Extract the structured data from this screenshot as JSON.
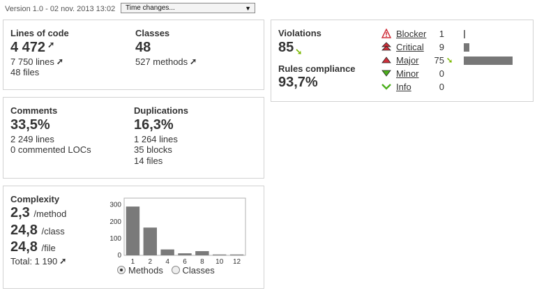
{
  "header": {
    "version_text": "Version 1.0 - 02 nov. 2013 13:02",
    "time_select": "Time changes..."
  },
  "size": {
    "loc_title": "Lines of code",
    "loc_value": "4 472",
    "lines": "7 750 lines",
    "files": "48 files",
    "classes_title": "Classes",
    "classes_value": "48",
    "methods": "527 methods"
  },
  "comments": {
    "title": "Comments",
    "value": "33,5%",
    "lines": "2 249 lines",
    "commented_locs": "0 commented LOCs"
  },
  "duplications": {
    "title": "Duplications",
    "value": "16,3%",
    "lines": "1 264 lines",
    "blocks": "35 blocks",
    "files": "14 files"
  },
  "complexity": {
    "title": "Complexity",
    "per_method_value": "2,3",
    "per_method_unit": "/method",
    "per_class_value": "24,8",
    "per_class_unit": "/class",
    "per_file_value": "24,8",
    "per_file_unit": "/file",
    "total": "Total: 1 190",
    "radio_methods": "Methods",
    "radio_classes": "Classes",
    "selected": "Methods"
  },
  "violations": {
    "title": "Violations",
    "value": "85",
    "compliance_title": "Rules compliance",
    "compliance_value": "93,7%",
    "severities": [
      {
        "label": "Blocker",
        "count": "1",
        "value": 1,
        "icon": "blocker-icon",
        "color": "#d02f3a"
      },
      {
        "label": "Critical",
        "count": "9",
        "value": 9,
        "icon": "critical-icon",
        "color": "#d02f3a"
      },
      {
        "label": "Major",
        "count": "75",
        "value": 75,
        "icon": "major-icon",
        "color": "#d02f3a"
      },
      {
        "label": "Minor",
        "count": "0",
        "value": 0,
        "icon": "minor-icon",
        "color": "#4caf1c"
      },
      {
        "label": "Info",
        "count": "0",
        "value": 0,
        "icon": "info-icon",
        "color": "#4caf1c"
      }
    ],
    "max_count": 75
  },
  "chart_data": {
    "type": "bar",
    "categories": [
      "1",
      "2",
      "4",
      "6",
      "8",
      "10",
      "12"
    ],
    "values": [
      290,
      165,
      35,
      12,
      25,
      5,
      5
    ],
    "ylim": [
      0,
      340
    ],
    "yticks": [
      "0",
      "100",
      "200",
      "300"
    ],
    "bar_color": "#7a7a7a"
  }
}
